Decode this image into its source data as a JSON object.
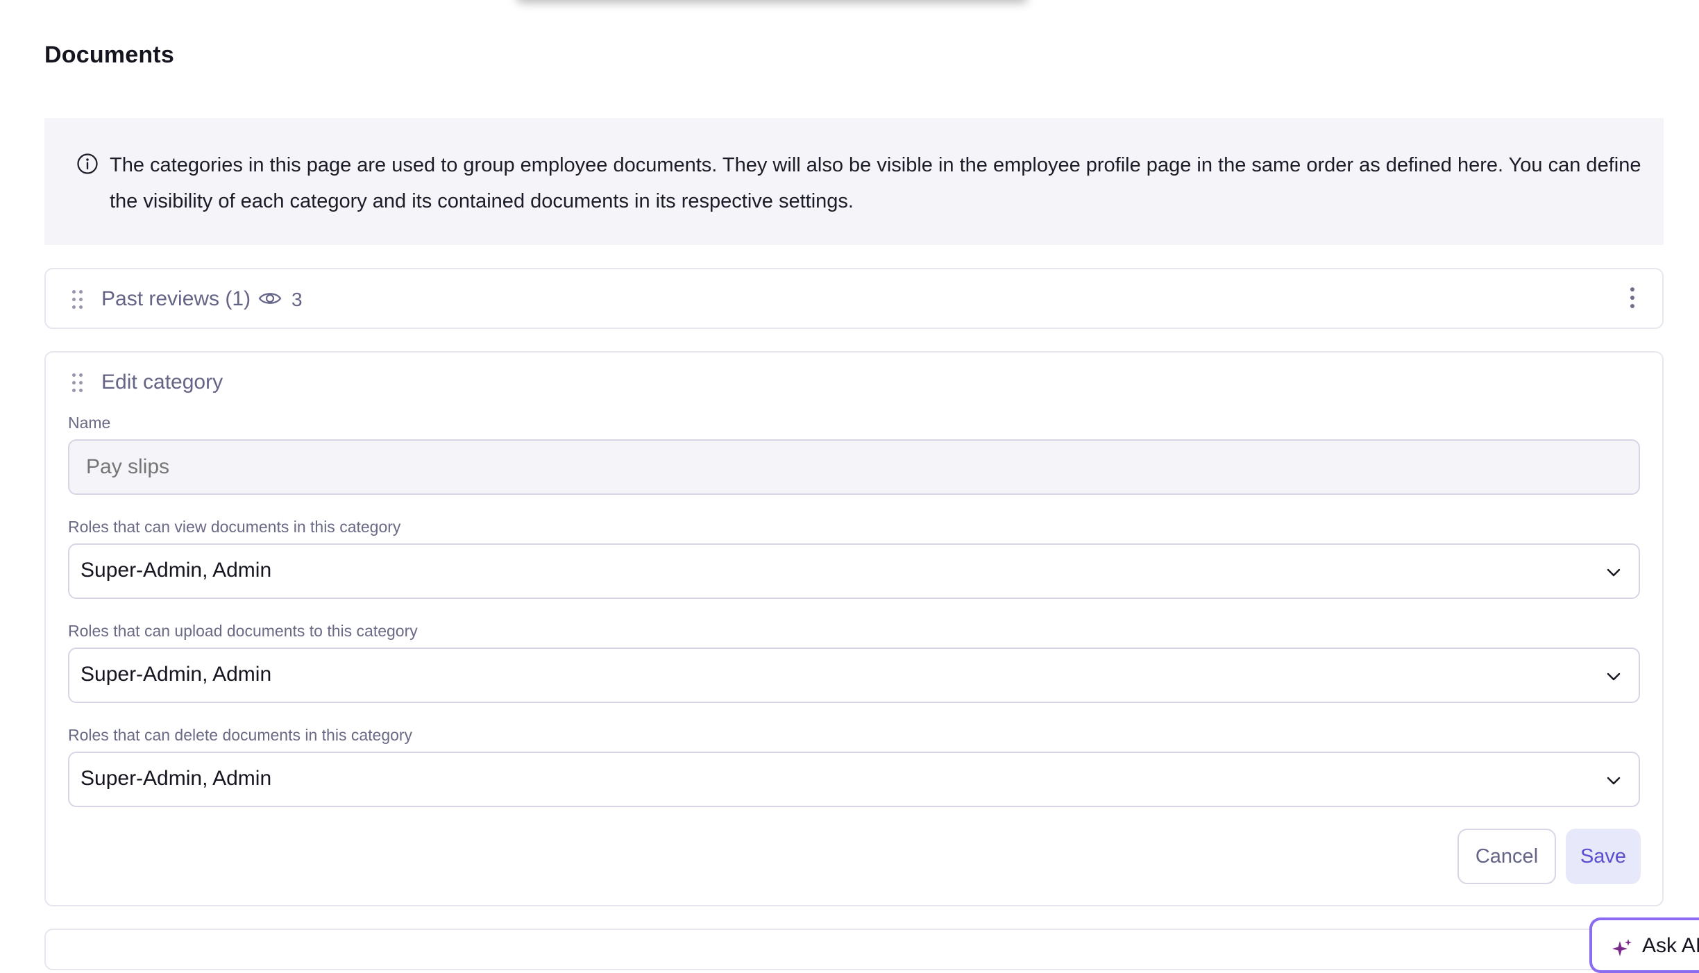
{
  "page": {
    "title": "Documents"
  },
  "info_banner": {
    "icon": "info-icon",
    "text": "The categories in this page are used to group employee documents. They will also be visible in the employee profile page in the same order as defined here. You can define the visibility of each category and its contained documents in its respective settings."
  },
  "categories": [
    {
      "title": "Past reviews (1)",
      "visibility_count": "3",
      "icons": [
        "drag-handle-icon",
        "eye-icon",
        "kebab-menu-icon"
      ]
    }
  ],
  "edit_category": {
    "title": "Edit category",
    "name_label": "Name",
    "name_placeholder": "Pay slips",
    "view_roles_label": "Roles that can view documents in this category",
    "view_roles_value": "Super-Admin, Admin",
    "upload_roles_label": "Roles that can upload documents to this category",
    "upload_roles_value": "Super-Admin, Admin",
    "delete_roles_label": "Roles that can delete documents in this category",
    "delete_roles_value": "Super-Admin, Admin",
    "cancel_label": "Cancel",
    "save_label": "Save"
  },
  "ask_ai": {
    "label": "Ask AI",
    "icon": "sparkle-icon"
  },
  "colors": {
    "banner_bg": "#f4f4f9",
    "muted_text": "#646487",
    "accent": "#5a4fcf",
    "save_bg": "#e8e8fb",
    "border": "#e6e6ef"
  }
}
